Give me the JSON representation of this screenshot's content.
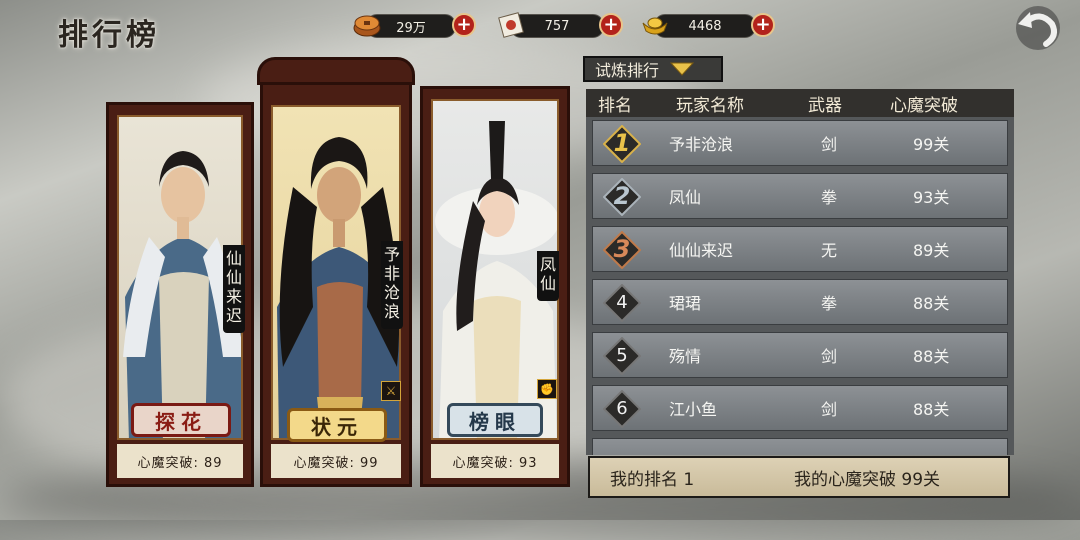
{
  "title": "排行榜",
  "resources": [
    {
      "icon": "copper-coin-icon",
      "value": "29万"
    },
    {
      "icon": "scroll-token-icon",
      "value": "757"
    },
    {
      "icon": "gold-ingot-icon",
      "value": "4468"
    }
  ],
  "plus_label": "+",
  "category": {
    "selected": "试炼排行"
  },
  "podium": [
    {
      "place": "探花",
      "name": "仙仙来迟",
      "name_chars": [
        "仙",
        "仙",
        "来",
        "迟"
      ],
      "score_text": "心魔突破: 89"
    },
    {
      "place": "状元",
      "name": "予非沧浪",
      "name_chars": [
        "予",
        "非",
        "沧",
        "浪"
      ],
      "score_text": "心魔突破: 99"
    },
    {
      "place": "榜眼",
      "name": "凤仙",
      "name_chars": [
        "凤",
        "仙"
      ],
      "score_text": "心魔突破: 93"
    }
  ],
  "table": {
    "headers": [
      "排名",
      "玩家名称",
      "武器",
      "心魔突破"
    ],
    "rows": [
      {
        "rank": "1",
        "name": "予非沧浪",
        "weapon": "剑",
        "stage": "99关"
      },
      {
        "rank": "2",
        "name": "凤仙",
        "weapon": "拳",
        "stage": "93关"
      },
      {
        "rank": "3",
        "name": "仙仙来迟",
        "weapon": "无",
        "stage": "89关"
      },
      {
        "rank": "4",
        "name": "珺珺",
        "weapon": "拳",
        "stage": "88关"
      },
      {
        "rank": "5",
        "name": "殇情",
        "weapon": "剑",
        "stage": "88关"
      },
      {
        "rank": "6",
        "name": "江小鱼",
        "weapon": "剑",
        "stage": "88关"
      }
    ]
  },
  "footer": {
    "my_rank": "我的排名 1",
    "my_stage": "我的心魔突破 99关"
  }
}
